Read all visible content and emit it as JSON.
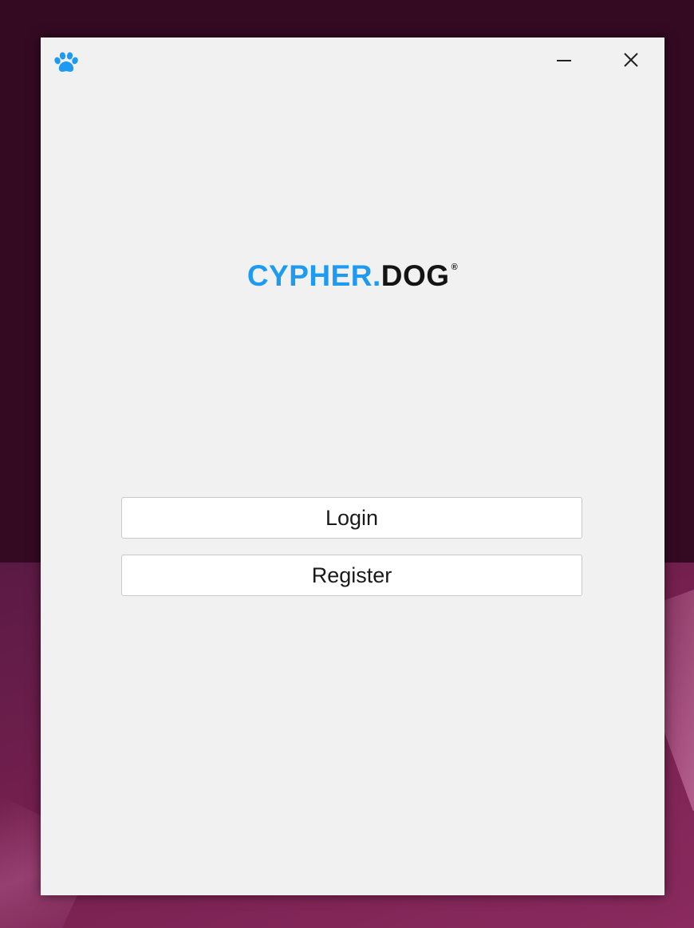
{
  "app": {
    "logo": {
      "part_primary": "CYPHER.",
      "part_secondary": "DOG",
      "registered_mark": "®"
    },
    "icon": "paw-icon"
  },
  "window_controls": {
    "minimize_icon": "minimize-icon",
    "close_icon": "close-icon"
  },
  "actions": {
    "login_label": "Login",
    "register_label": "Register"
  },
  "colors": {
    "brand_blue": "#1e9af1",
    "brand_dark": "#141414",
    "window_bg": "#f1f1f1",
    "desktop_bg": "#340a22"
  }
}
